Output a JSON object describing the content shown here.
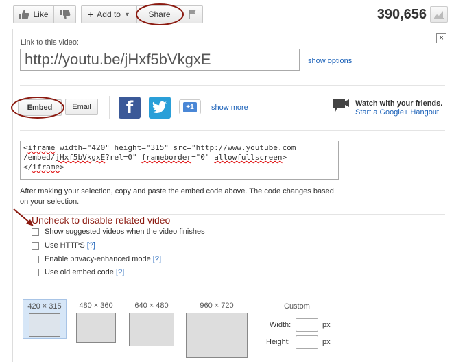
{
  "toolbar": {
    "like_label": "Like",
    "add_label": "Add to",
    "share_label": "Share",
    "views": "390,656"
  },
  "share_panel": {
    "link_label": "Link to this video:",
    "url": "http://youtu.be/jHxf5bVkgxE",
    "show_options": "show options",
    "embed_label": "Embed",
    "email_label": "Email",
    "social": [
      {
        "name": "facebook",
        "glyph": "f",
        "color": "#3b5998"
      },
      {
        "name": "twitter",
        "glyph": "t",
        "color": "#2a9fd8"
      },
      {
        "name": "google-plus",
        "glyph": "+1",
        "color": "#4a87d6"
      }
    ],
    "show_more": "show more",
    "hangout_title": "Watch with your friends.",
    "hangout_link": "Start a Google+ Hangout"
  },
  "embed": {
    "code_line1": "<",
    "code_kw1": "iframe",
    "code_line1b": " width=\"420\" height=\"315\" src=\"http://www.youtube.com",
    "code_line2a": "/embed/",
    "code_kw2": "jHxf5bVkgxE",
    "code_line2b": "?rel=0\" ",
    "code_kw3": "frameborder",
    "code_line2c": "=\"0\" ",
    "code_kw4": "allowfullscreen",
    "code_line2d": ">",
    "code_line3a": "</",
    "code_kw5": "iframe",
    "code_line3b": ">",
    "info": "After making your selection, copy and paste the embed code above. The code changes based on your selection.",
    "annotation": "Uncheck to disable related video",
    "options": [
      {
        "label": "Show suggested videos when the video finishes",
        "help": ""
      },
      {
        "label": "Use HTTPS",
        "help": "[?]"
      },
      {
        "label": "Enable privacy-enhanced mode",
        "help": "[?]"
      },
      {
        "label": "Use old embed code",
        "help": "[?]"
      }
    ],
    "sizes": [
      {
        "label": "420 × 315",
        "selected": true
      },
      {
        "label": "480 × 360",
        "selected": false
      },
      {
        "label": "640 × 480",
        "selected": false
      },
      {
        "label": "960 × 720",
        "selected": false
      }
    ],
    "custom_label": "Custom",
    "width_label": "Width:",
    "height_label": "Height:",
    "unit": "px"
  }
}
